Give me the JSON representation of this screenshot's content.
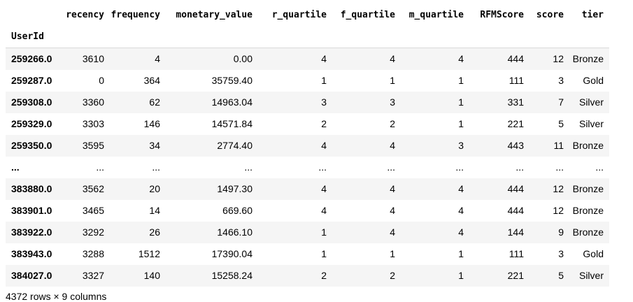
{
  "table": {
    "columns": [
      "recency",
      "frequency",
      "monetary_value",
      "r_quartile",
      "f_quartile",
      "m_quartile",
      "RFMScore",
      "score",
      "tier"
    ],
    "index_name": "UserId",
    "rows": [
      {
        "index": "259266.0",
        "cells": [
          "3610",
          "4",
          "0.00",
          "4",
          "4",
          "4",
          "444",
          "12",
          "Bronze"
        ]
      },
      {
        "index": "259287.0",
        "cells": [
          "0",
          "364",
          "35759.40",
          "1",
          "1",
          "1",
          "111",
          "3",
          "Gold"
        ]
      },
      {
        "index": "259308.0",
        "cells": [
          "3360",
          "62",
          "14963.04",
          "3",
          "3",
          "1",
          "331",
          "7",
          "Silver"
        ]
      },
      {
        "index": "259329.0",
        "cells": [
          "3303",
          "146",
          "14571.84",
          "2",
          "2",
          "1",
          "221",
          "5",
          "Silver"
        ]
      },
      {
        "index": "259350.0",
        "cells": [
          "3595",
          "34",
          "2774.40",
          "4",
          "4",
          "3",
          "443",
          "11",
          "Bronze"
        ]
      },
      {
        "index": "...",
        "cells": [
          "...",
          "...",
          "...",
          "...",
          "...",
          "...",
          "...",
          "...",
          "..."
        ]
      },
      {
        "index": "383880.0",
        "cells": [
          "3562",
          "20",
          "1497.30",
          "4",
          "4",
          "4",
          "444",
          "12",
          "Bronze"
        ]
      },
      {
        "index": "383901.0",
        "cells": [
          "3465",
          "14",
          "669.60",
          "4",
          "4",
          "4",
          "444",
          "12",
          "Bronze"
        ]
      },
      {
        "index": "383922.0",
        "cells": [
          "3292",
          "26",
          "1466.10",
          "1",
          "4",
          "4",
          "144",
          "9",
          "Bronze"
        ]
      },
      {
        "index": "383943.0",
        "cells": [
          "3288",
          "1512",
          "17390.04",
          "1",
          "1",
          "1",
          "111",
          "3",
          "Gold"
        ]
      },
      {
        "index": "384027.0",
        "cells": [
          "3327",
          "140",
          "15258.24",
          "2",
          "2",
          "1",
          "221",
          "5",
          "Silver"
        ]
      }
    ]
  },
  "shape_caption": "4372 rows × 9 columns"
}
